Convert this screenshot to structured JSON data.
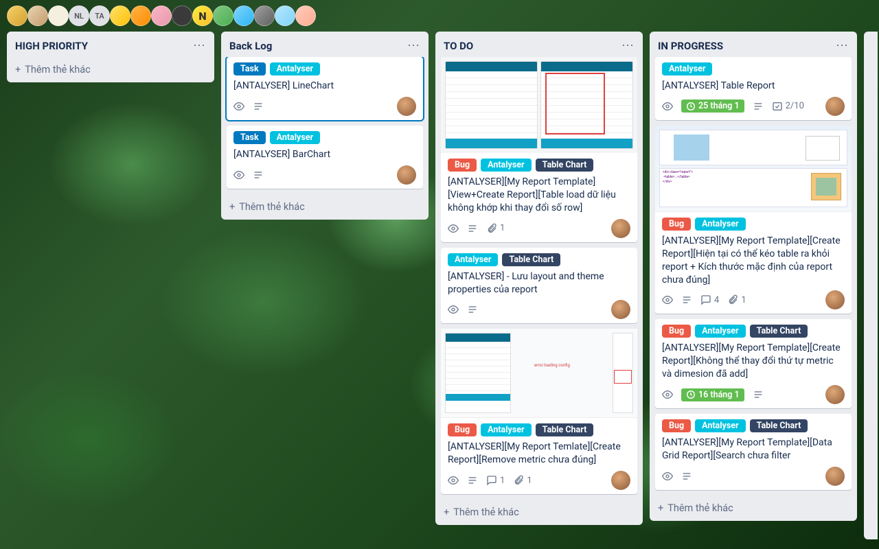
{
  "avatars": [
    {
      "cls": "gold",
      "txt": ""
    },
    {
      "cls": "anime",
      "txt": ""
    },
    {
      "cls": "paper",
      "txt": ""
    },
    {
      "cls": "text",
      "txt": "NL"
    },
    {
      "cls": "text",
      "txt": "TA"
    },
    {
      "cls": "yellow",
      "txt": ""
    },
    {
      "cls": "orange",
      "txt": ""
    },
    {
      "cls": "pink",
      "txt": ""
    },
    {
      "cls": "dark",
      "txt": ""
    },
    {
      "cls": "yellowN",
      "txt": "N"
    },
    {
      "cls": "green",
      "txt": ""
    },
    {
      "cls": "sky",
      "txt": ""
    },
    {
      "cls": "grey",
      "txt": ""
    },
    {
      "cls": "lightblue",
      "txt": ""
    },
    {
      "cls": "peach",
      "txt": ""
    }
  ],
  "add_card_label": "Thêm thẻ khác",
  "lists": {
    "high_priority": {
      "title": "HIGH PRIORITY"
    },
    "backlog": {
      "title": "Back Log",
      "cards": [
        {
          "labels": [
            "Task",
            "Antalyser"
          ],
          "title": "[ANTALYSER] LineChart",
          "selected": true
        },
        {
          "labels": [
            "Task",
            "Antalyser"
          ],
          "title": "[ANTALYSER] BarChart"
        }
      ]
    },
    "todo": {
      "title": "TO DO",
      "cards": [
        {
          "cover": "table-pair",
          "labels": [
            "Bug",
            "Antalyser",
            "Table Chart"
          ],
          "title": "[ANTALYSER][My Report Template][View+Create Report][Table load dữ liệu không khớp khi thay đổi số row]",
          "attachments": 1
        },
        {
          "labels": [
            "Antalyser",
            "Table Chart"
          ],
          "title": "[ANTALYSER] - Lưu layout and theme properties của report"
        },
        {
          "cover": "dev-panel",
          "labels": [
            "Bug",
            "Antalyser",
            "Table Chart"
          ],
          "title": "[ANTALYSER][My Report Temlate][Create Report][Remove metric chưa đúng]",
          "comments": 1,
          "attachments": 1
        }
      ]
    },
    "in_progress": {
      "title": "IN PROGRESS",
      "cards": [
        {
          "labels": [
            "Antalyser"
          ],
          "title": "[ANTALYSER] Table Report",
          "due": "25 tháng 1",
          "checklist": "2/10"
        },
        {
          "cover": "devtools",
          "labels": [
            "Bug",
            "Antalyser"
          ],
          "title": "[ANTALYSER][My Report Template][Create Report][Hiện tại có thể kéo table ra khỏi report + Kích thước mặc định của report chưa đúng]",
          "comments": 4,
          "attachments": 1
        },
        {
          "labels": [
            "Bug",
            "Antalyser",
            "Table Chart"
          ],
          "title": "[ANTALYSER][My Report Template][Create Report][Không thể thay đổi thứ tự metric và dimesion đã add]",
          "due": "16 tháng 1"
        },
        {
          "labels": [
            "Bug",
            "Antalyser",
            "Table Chart"
          ],
          "title": "[ANTALYSER][My Report Template][Data Grid Report][Search chưa filter"
        }
      ]
    }
  },
  "label_styles": {
    "Task": "task",
    "Antalyser": "antalyser",
    "Bug": "bug",
    "Table Chart": "tablechart"
  }
}
